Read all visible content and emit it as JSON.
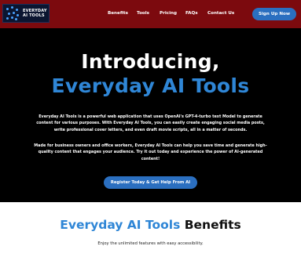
{
  "nav": {
    "logo_text_line1": "EVERYDAY",
    "logo_text_line2": "AI TOOLS",
    "links": [
      "Benefits",
      "Tools",
      "Pricing",
      "FAQs",
      "Contact Us"
    ],
    "signup_label": "Sign Up Now"
  },
  "hero": {
    "title_line1": "Introducing,",
    "title_line2": "Everyday AI Tools",
    "paragraph1": "Everyday AI Tools is a powerful web application that uses OpenAI's GPT-4-turbo text Model to generate content for various purposes. With Everyday AI Tools, you can easily create engaging social media posts, write professional cover letters, and even draft movie scripts, all in a matter of seconds.",
    "paragraph2": "Made for business owners and office workers, Everyday AI Tools can help you save time and generate high-quality content that engages your audience. Try it out today and experience the power of AI-generated content!",
    "cta_label": "Register Today & Get Help From AI"
  },
  "benefits": {
    "title_blue": "Everyday AI Tools",
    "title_dark": " Benefits",
    "subtitle": "Enjoy the unlimited features with easy accessibility."
  },
  "colors": {
    "nav_bg": "#7c0a0e",
    "accent_blue": "#2f86d6",
    "button_blue": "#2b6fc0",
    "hero_bg": "#000000"
  }
}
